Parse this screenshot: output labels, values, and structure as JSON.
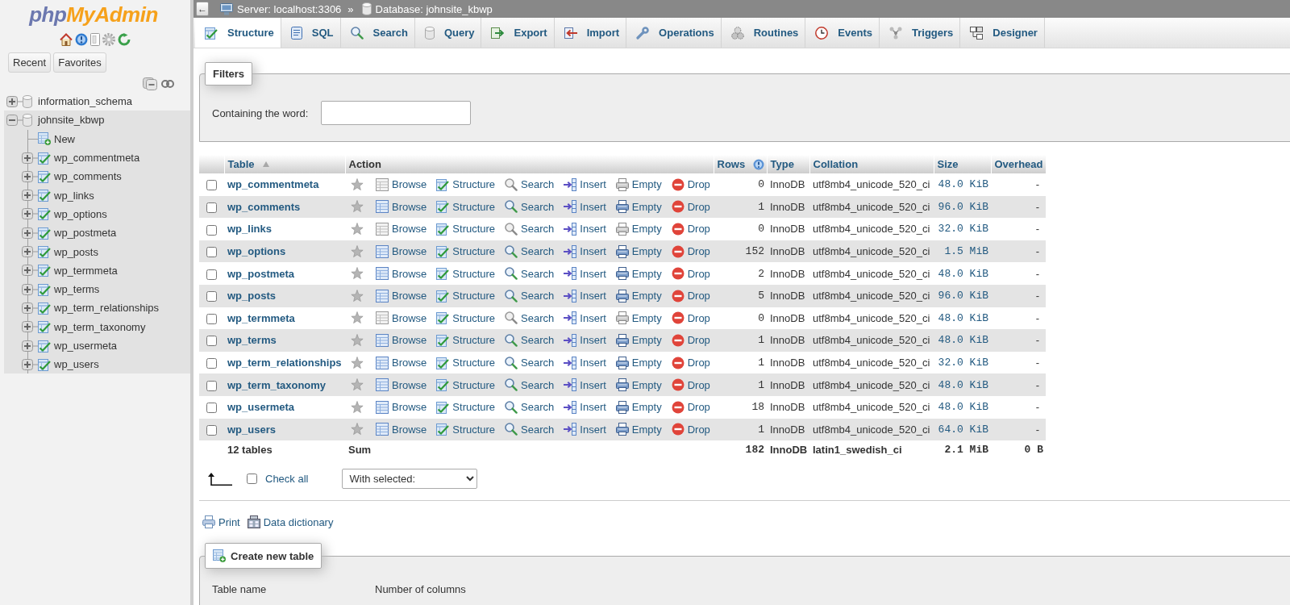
{
  "sidebar": {
    "logo_parts": [
      "php",
      "MyAdmin"
    ],
    "buttons": [
      "Recent",
      "Favorites"
    ],
    "tree": [
      {
        "kind": "database",
        "label": "information_schema",
        "expanded": false,
        "selected": false
      },
      {
        "kind": "database",
        "label": "johnsite_kbwp",
        "expanded": true,
        "selected": true,
        "children": [
          {
            "kind": "new",
            "label": "New",
            "selected": false
          },
          {
            "kind": "table",
            "label": "wp_commentmeta",
            "expanded": false,
            "selected": false
          },
          {
            "kind": "table",
            "label": "wp_comments",
            "expanded": false,
            "selected": false
          },
          {
            "kind": "table",
            "label": "wp_links",
            "expanded": false,
            "selected": false
          },
          {
            "kind": "table",
            "label": "wp_options",
            "expanded": false,
            "selected": false
          },
          {
            "kind": "table",
            "label": "wp_postmeta",
            "expanded": false,
            "selected": false
          },
          {
            "kind": "table",
            "label": "wp_posts",
            "expanded": false,
            "selected": false
          },
          {
            "kind": "table",
            "label": "wp_termmeta",
            "expanded": false,
            "selected": false
          },
          {
            "kind": "table",
            "label": "wp_terms",
            "expanded": false,
            "selected": false
          },
          {
            "kind": "table",
            "label": "wp_term_relationships",
            "expanded": false,
            "selected": false
          },
          {
            "kind": "table",
            "label": "wp_term_taxonomy",
            "expanded": false,
            "selected": false
          },
          {
            "kind": "table",
            "label": "wp_usermeta",
            "expanded": false,
            "selected": false
          },
          {
            "kind": "table",
            "label": "wp_users",
            "expanded": false,
            "selected": false
          }
        ]
      }
    ]
  },
  "breadcrumb": {
    "collapse_button": "←",
    "separator": "»",
    "items": [
      {
        "kind": "server",
        "label": "Server: localhost:3306"
      },
      {
        "kind": "database",
        "label": "Database: johnsite_kbwp"
      }
    ]
  },
  "tabs": [
    {
      "kind": "structure",
      "label": "Structure",
      "selected": true
    },
    {
      "kind": "sql",
      "label": "SQL",
      "selected": false
    },
    {
      "kind": "search",
      "label": "Search",
      "selected": false
    },
    {
      "kind": "query",
      "label": "Query",
      "selected": false
    },
    {
      "kind": "export",
      "label": "Export",
      "selected": false
    },
    {
      "kind": "import",
      "label": "Import",
      "selected": false
    },
    {
      "kind": "operations",
      "label": "Operations",
      "selected": false
    },
    {
      "kind": "routines",
      "label": "Routines",
      "selected": false
    },
    {
      "kind": "events",
      "label": "Events",
      "selected": false
    },
    {
      "kind": "triggers",
      "label": "Triggers",
      "selected": false
    },
    {
      "kind": "designer",
      "label": "Designer",
      "selected": false
    }
  ],
  "filters": {
    "legend": "Filters",
    "label": "Containing the word:"
  },
  "table": {
    "columns": [
      {
        "kind": "sorted",
        "label": "Table"
      },
      {
        "kind": "plain",
        "label": "Action"
      },
      {
        "kind": "help",
        "label": "Rows"
      },
      {
        "kind": "link",
        "label": "Type"
      },
      {
        "kind": "link",
        "label": "Collation"
      },
      {
        "kind": "link",
        "label": "Size"
      },
      {
        "kind": "link",
        "label": "Overhead"
      }
    ],
    "rows": [
      {
        "checked": false,
        "name": "wp_commentmeta",
        "favorite": false,
        "no_data": true,
        "actions": [
          {
            "kind": "browse",
            "label": "Browse"
          },
          {
            "kind": "structure",
            "label": "Structure"
          },
          {
            "kind": "search",
            "label": "Search"
          },
          {
            "kind": "insert",
            "label": "Insert"
          },
          {
            "kind": "empty",
            "label": "Empty"
          },
          {
            "kind": "drop",
            "label": "Drop"
          }
        ],
        "rows": "0",
        "type": "InnoDB",
        "collation": "utf8mb4_unicode_520_ci",
        "size": "48.0 KiB",
        "overhead": "-"
      },
      {
        "checked": false,
        "name": "wp_comments",
        "favorite": false,
        "no_data": false,
        "actions": [
          {
            "kind": "browse",
            "label": "Browse"
          },
          {
            "kind": "structure",
            "label": "Structure"
          },
          {
            "kind": "search",
            "label": "Search"
          },
          {
            "kind": "insert",
            "label": "Insert"
          },
          {
            "kind": "empty",
            "label": "Empty"
          },
          {
            "kind": "drop",
            "label": "Drop"
          }
        ],
        "rows": "1",
        "type": "InnoDB",
        "collation": "utf8mb4_unicode_520_ci",
        "size": "96.0 KiB",
        "overhead": "-"
      },
      {
        "checked": false,
        "name": "wp_links",
        "favorite": false,
        "no_data": true,
        "actions": [
          {
            "kind": "browse",
            "label": "Browse"
          },
          {
            "kind": "structure",
            "label": "Structure"
          },
          {
            "kind": "search",
            "label": "Search"
          },
          {
            "kind": "insert",
            "label": "Insert"
          },
          {
            "kind": "empty",
            "label": "Empty"
          },
          {
            "kind": "drop",
            "label": "Drop"
          }
        ],
        "rows": "0",
        "type": "InnoDB",
        "collation": "utf8mb4_unicode_520_ci",
        "size": "32.0 KiB",
        "overhead": "-"
      },
      {
        "checked": false,
        "name": "wp_options",
        "favorite": false,
        "no_data": false,
        "actions": [
          {
            "kind": "browse",
            "label": "Browse"
          },
          {
            "kind": "structure",
            "label": "Structure"
          },
          {
            "kind": "search",
            "label": "Search"
          },
          {
            "kind": "insert",
            "label": "Insert"
          },
          {
            "kind": "empty",
            "label": "Empty"
          },
          {
            "kind": "drop",
            "label": "Drop"
          }
        ],
        "rows": "152",
        "type": "InnoDB",
        "collation": "utf8mb4_unicode_520_ci",
        "size": "1.5 MiB",
        "overhead": "-"
      },
      {
        "checked": false,
        "name": "wp_postmeta",
        "favorite": false,
        "no_data": false,
        "actions": [
          {
            "kind": "browse",
            "label": "Browse"
          },
          {
            "kind": "structure",
            "label": "Structure"
          },
          {
            "kind": "search",
            "label": "Search"
          },
          {
            "kind": "insert",
            "label": "Insert"
          },
          {
            "kind": "empty",
            "label": "Empty"
          },
          {
            "kind": "drop",
            "label": "Drop"
          }
        ],
        "rows": "2",
        "type": "InnoDB",
        "collation": "utf8mb4_unicode_520_ci",
        "size": "48.0 KiB",
        "overhead": "-"
      },
      {
        "checked": false,
        "name": "wp_posts",
        "favorite": false,
        "no_data": false,
        "actions": [
          {
            "kind": "browse",
            "label": "Browse"
          },
          {
            "kind": "structure",
            "label": "Structure"
          },
          {
            "kind": "search",
            "label": "Search"
          },
          {
            "kind": "insert",
            "label": "Insert"
          },
          {
            "kind": "empty",
            "label": "Empty"
          },
          {
            "kind": "drop",
            "label": "Drop"
          }
        ],
        "rows": "5",
        "type": "InnoDB",
        "collation": "utf8mb4_unicode_520_ci",
        "size": "96.0 KiB",
        "overhead": "-"
      },
      {
        "checked": false,
        "name": "wp_termmeta",
        "favorite": false,
        "no_data": true,
        "actions": [
          {
            "kind": "browse",
            "label": "Browse"
          },
          {
            "kind": "structure",
            "label": "Structure"
          },
          {
            "kind": "search",
            "label": "Search"
          },
          {
            "kind": "insert",
            "label": "Insert"
          },
          {
            "kind": "empty",
            "label": "Empty"
          },
          {
            "kind": "drop",
            "label": "Drop"
          }
        ],
        "rows": "0",
        "type": "InnoDB",
        "collation": "utf8mb4_unicode_520_ci",
        "size": "48.0 KiB",
        "overhead": "-"
      },
      {
        "checked": false,
        "name": "wp_terms",
        "favorite": false,
        "no_data": false,
        "actions": [
          {
            "kind": "browse",
            "label": "Browse"
          },
          {
            "kind": "structure",
            "label": "Structure"
          },
          {
            "kind": "search",
            "label": "Search"
          },
          {
            "kind": "insert",
            "label": "Insert"
          },
          {
            "kind": "empty",
            "label": "Empty"
          },
          {
            "kind": "drop",
            "label": "Drop"
          }
        ],
        "rows": "1",
        "type": "InnoDB",
        "collation": "utf8mb4_unicode_520_ci",
        "size": "48.0 KiB",
        "overhead": "-"
      },
      {
        "checked": false,
        "name": "wp_term_relationships",
        "favorite": false,
        "no_data": false,
        "actions": [
          {
            "kind": "browse",
            "label": "Browse"
          },
          {
            "kind": "structure",
            "label": "Structure"
          },
          {
            "kind": "search",
            "label": "Search"
          },
          {
            "kind": "insert",
            "label": "Insert"
          },
          {
            "kind": "empty",
            "label": "Empty"
          },
          {
            "kind": "drop",
            "label": "Drop"
          }
        ],
        "rows": "1",
        "type": "InnoDB",
        "collation": "utf8mb4_unicode_520_ci",
        "size": "32.0 KiB",
        "overhead": "-"
      },
      {
        "checked": false,
        "name": "wp_term_taxonomy",
        "favorite": false,
        "no_data": false,
        "actions": [
          {
            "kind": "browse",
            "label": "Browse"
          },
          {
            "kind": "structure",
            "label": "Structure"
          },
          {
            "kind": "search",
            "label": "Search"
          },
          {
            "kind": "insert",
            "label": "Insert"
          },
          {
            "kind": "empty",
            "label": "Empty"
          },
          {
            "kind": "drop",
            "label": "Drop"
          }
        ],
        "rows": "1",
        "type": "InnoDB",
        "collation": "utf8mb4_unicode_520_ci",
        "size": "48.0 KiB",
        "overhead": "-"
      },
      {
        "checked": false,
        "name": "wp_usermeta",
        "favorite": false,
        "no_data": false,
        "actions": [
          {
            "kind": "browse",
            "label": "Browse"
          },
          {
            "kind": "structure",
            "label": "Structure"
          },
          {
            "kind": "search",
            "label": "Search"
          },
          {
            "kind": "insert",
            "label": "Insert"
          },
          {
            "kind": "empty",
            "label": "Empty"
          },
          {
            "kind": "drop",
            "label": "Drop"
          }
        ],
        "rows": "18",
        "type": "InnoDB",
        "collation": "utf8mb4_unicode_520_ci",
        "size": "48.0 KiB",
        "overhead": "-"
      },
      {
        "checked": false,
        "name": "wp_users",
        "favorite": false,
        "no_data": false,
        "actions": [
          {
            "kind": "browse",
            "label": "Browse"
          },
          {
            "kind": "structure",
            "label": "Structure"
          },
          {
            "kind": "search",
            "label": "Search"
          },
          {
            "kind": "insert",
            "label": "Insert"
          },
          {
            "kind": "empty",
            "label": "Empty"
          },
          {
            "kind": "drop",
            "label": "Drop"
          }
        ],
        "rows": "1",
        "type": "InnoDB",
        "collation": "utf8mb4_unicode_520_ci",
        "size": "64.0 KiB",
        "overhead": "-"
      }
    ],
    "footer": {
      "label": "12 tables",
      "action": "Sum",
      "rows": "182",
      "type": "InnoDB",
      "collation": "latin1_swedish_ci",
      "size": "2.1 MiB",
      "overhead": "0 B"
    }
  },
  "bulk_actions": {
    "check_all": {
      "label": "Check all",
      "checked": false
    },
    "select_value": "With selected:"
  },
  "links": [
    {
      "kind": "print",
      "label": "Print"
    },
    {
      "kind": "dictionary",
      "label": "Data dictionary"
    }
  ],
  "create_table": {
    "legend": "Create new table",
    "labels": [
      "Table name",
      "Number of columns"
    ]
  }
}
